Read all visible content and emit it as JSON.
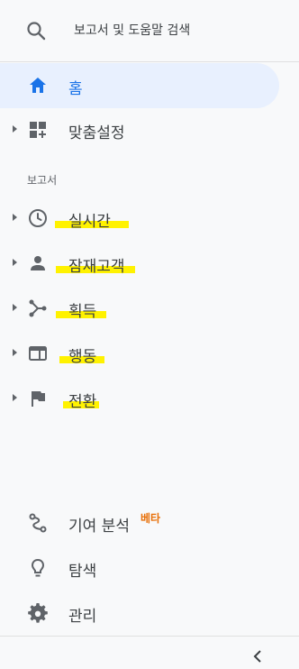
{
  "search": {
    "label": "보고서 및 도움말 검색"
  },
  "nav_top": [
    {
      "label": "홈"
    },
    {
      "label": "맞춤설정"
    }
  ],
  "reports_section": {
    "label": "보고서",
    "items": [
      {
        "label": "실시간"
      },
      {
        "label": "잠재고객"
      },
      {
        "label": "획득"
      },
      {
        "label": "행동"
      },
      {
        "label": "전환"
      }
    ]
  },
  "bottom": {
    "attribution": {
      "label": "기여 분석",
      "badge": "베타"
    },
    "explore": {
      "label": "탐색"
    },
    "admin": {
      "label": "관리"
    }
  },
  "colors": {
    "accent": "#1a73e8",
    "active_bg": "#e8f0fe",
    "highlight": "#fff200",
    "beta": "#e8710a"
  }
}
